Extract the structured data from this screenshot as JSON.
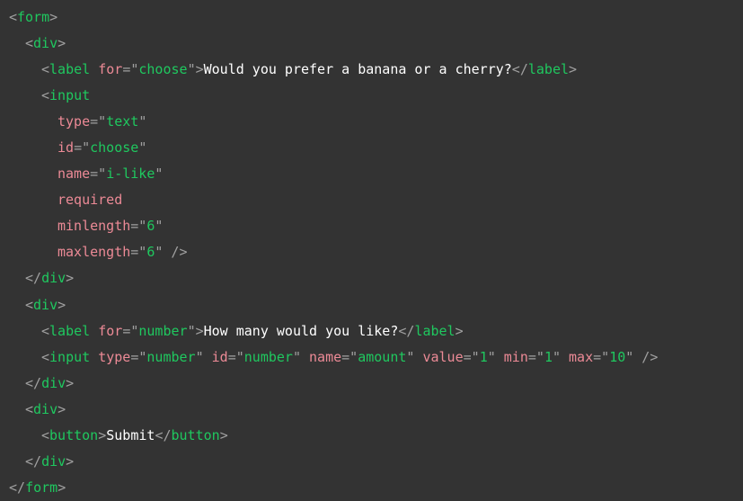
{
  "theme": {
    "background": "#333333",
    "tag_color": "#1fc85f",
    "punctuation_color": "#a0a0a0",
    "attribute_color": "#ec8a96",
    "string_color": "#1fc85f",
    "text_color": "#ffffff"
  },
  "code": {
    "form_tag": "form",
    "div_tag": "div",
    "label_tag": "label",
    "input_tag": "input",
    "button_tag": "button",
    "label1": {
      "attr_for": "for",
      "for_value": "choose",
      "text": "Would you prefer a banana or a cherry?"
    },
    "input1": {
      "attrs": [
        {
          "name": "type",
          "value": "text"
        },
        {
          "name": "id",
          "value": "choose"
        },
        {
          "name": "name",
          "value": "i-like"
        },
        {
          "name": "required",
          "value": null
        },
        {
          "name": "minlength",
          "value": "6"
        },
        {
          "name": "maxlength",
          "value": "6"
        }
      ]
    },
    "label2": {
      "attr_for": "for",
      "for_value": "number",
      "text": "How many would you like?"
    },
    "input2": {
      "attrs": [
        {
          "name": "type",
          "value": "number"
        },
        {
          "name": "id",
          "value": "number"
        },
        {
          "name": "name",
          "value": "amount"
        },
        {
          "name": "value",
          "value": "1"
        },
        {
          "name": "min",
          "value": "1"
        },
        {
          "name": "max",
          "value": "10"
        }
      ]
    },
    "button": {
      "text": "Submit"
    }
  }
}
